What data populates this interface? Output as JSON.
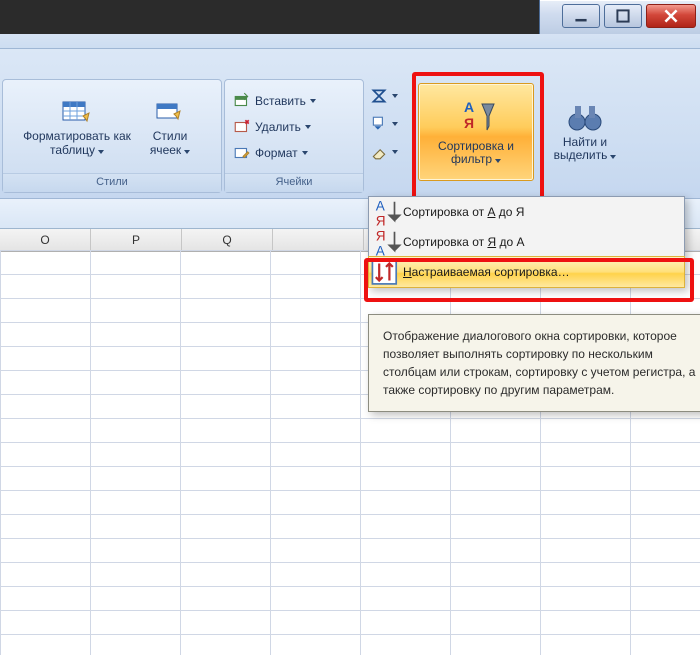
{
  "window": {
    "btn_min": "–",
    "btn_max": "❐",
    "btn_close": "✕"
  },
  "ribbon": {
    "styles": {
      "caption": "Стили",
      "format_as_table": "Форматировать как таблицу",
      "cell_styles": "Стили ячеек"
    },
    "cells": {
      "caption": "Ячейки",
      "insert": "Вставить",
      "delete": "Удалить",
      "format": "Формат"
    },
    "editing": {
      "sort_filter": "Сортировка и фильтр",
      "find_select": "Найти и выделить"
    }
  },
  "menu": {
    "sort_az": "Сортировка от А до Я",
    "sort_za": "Сортировка от Я до А",
    "custom_sort": "Настраиваемая сортировка…",
    "sort_az_u": "А",
    "sort_za_u": "Я",
    "custom_u": "Н"
  },
  "tooltip": {
    "text": "Отображение диалогового окна сортировки, которое позволяет выполнять сортировку по нескольким столбцам или строкам, сортировку с учетом регистра, а также сортировку по другим параметрам."
  },
  "columns": [
    "O",
    "P",
    "Q",
    "",
    "",
    "",
    "",
    ""
  ]
}
